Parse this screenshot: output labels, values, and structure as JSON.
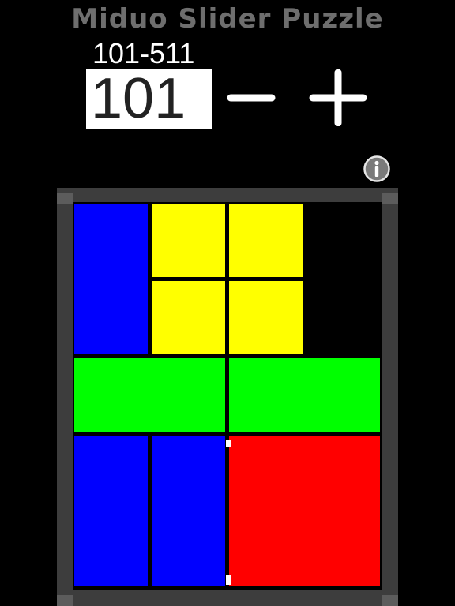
{
  "app": {
    "title": "Miduo Slider Puzzle"
  },
  "level": {
    "range": "101-511",
    "value": "101",
    "minus_icon": "minus-icon",
    "plus_icon": "plus-icon"
  },
  "info": {
    "icon": "info-icon"
  },
  "board": {
    "grid": {
      "cols": 4,
      "rows": 5
    },
    "colors": {
      "blue": "#0000ff",
      "yellow": "#ffff00",
      "green": "#00ff00",
      "red": "#ff0000",
      "frame": "#3d3d3d"
    },
    "tiles": [
      {
        "id": "blue-1",
        "color": "blue",
        "col": 0,
        "row": 0,
        "w": 1,
        "h": 2
      },
      {
        "id": "yellow-1",
        "color": "yellow",
        "col": 1,
        "row": 0,
        "w": 1,
        "h": 1
      },
      {
        "id": "yellow-2",
        "color": "yellow",
        "col": 2,
        "row": 0,
        "w": 1,
        "h": 1
      },
      {
        "id": "yellow-3",
        "color": "yellow",
        "col": 1,
        "row": 1,
        "w": 1,
        "h": 1
      },
      {
        "id": "yellow-4",
        "color": "yellow",
        "col": 2,
        "row": 1,
        "w": 1,
        "h": 1
      },
      {
        "id": "green-1",
        "color": "green",
        "col": 0,
        "row": 2,
        "w": 2,
        "h": 1
      },
      {
        "id": "green-2",
        "color": "green",
        "col": 2,
        "row": 2,
        "w": 2,
        "h": 1
      },
      {
        "id": "blue-2",
        "color": "blue",
        "col": 0,
        "row": 3,
        "w": 1,
        "h": 2
      },
      {
        "id": "blue-3",
        "color": "blue",
        "col": 1,
        "row": 3,
        "w": 1,
        "h": 2
      },
      {
        "id": "red-1",
        "color": "red",
        "col": 2,
        "row": 3,
        "w": 2,
        "h": 2
      }
    ]
  }
}
